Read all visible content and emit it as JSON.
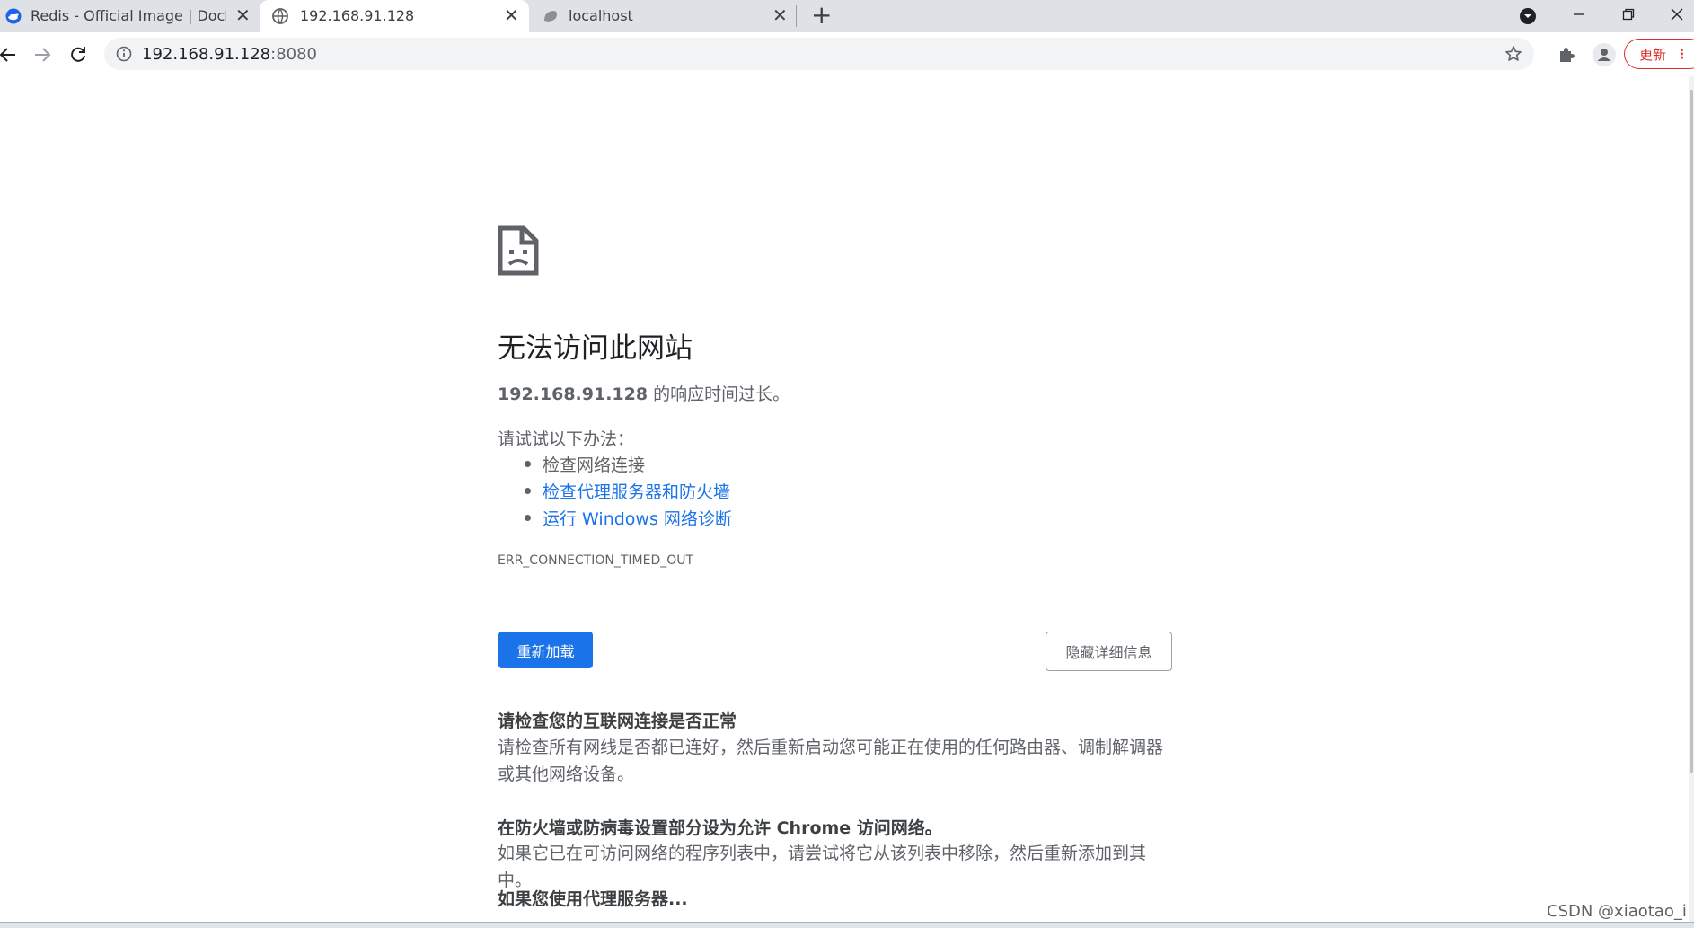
{
  "tabs": [
    {
      "title": "Redis - Official Image | Docker",
      "icon": "docker-whale-icon"
    },
    {
      "title": "192.168.91.128",
      "icon": "globe-icon"
    },
    {
      "title": "localhost",
      "icon": "generic-page-icon"
    }
  ],
  "tab_close_symbol": "✕",
  "new_tab_symbol": "+",
  "address_bar": {
    "host": "192.168.91.128",
    "port": ":8080"
  },
  "update_button": {
    "label": "更新"
  },
  "error_page": {
    "heading": "无法访问此网站",
    "host": "192.168.91.128",
    "cause_suffix": " 的响应时间过长。",
    "try_label": "请试试以下办法：",
    "suggestions": [
      "检查网络连接",
      "检查代理服务器和防火墙",
      "运行 Windows 网络诊断"
    ],
    "error_code": "ERR_CONNECTION_TIMED_OUT",
    "reload_label": "重新加载",
    "details_label": "隐藏详细信息",
    "sections": [
      {
        "title": "请检查您的互联网连接是否正常",
        "body": "请检查所有网线是否都已连好，然后重新启动您可能正在使用的任何路由器、调制解调器或其他网络设备。"
      },
      {
        "title": "在防火墙或防病毒设置部分设为允许 Chrome 访问网络。",
        "body": "如果它已在可访问网络的程序列表中，请尝试将它从该列表中移除，然后重新添加到其中。"
      },
      {
        "title": "如果您使用代理服务器..."
      }
    ]
  },
  "watermark": "CSDN @xiaotao_i",
  "colors": {
    "accent": "#1a73e8",
    "update_red": "#d93025",
    "tab_strip": "#dee1e6"
  }
}
